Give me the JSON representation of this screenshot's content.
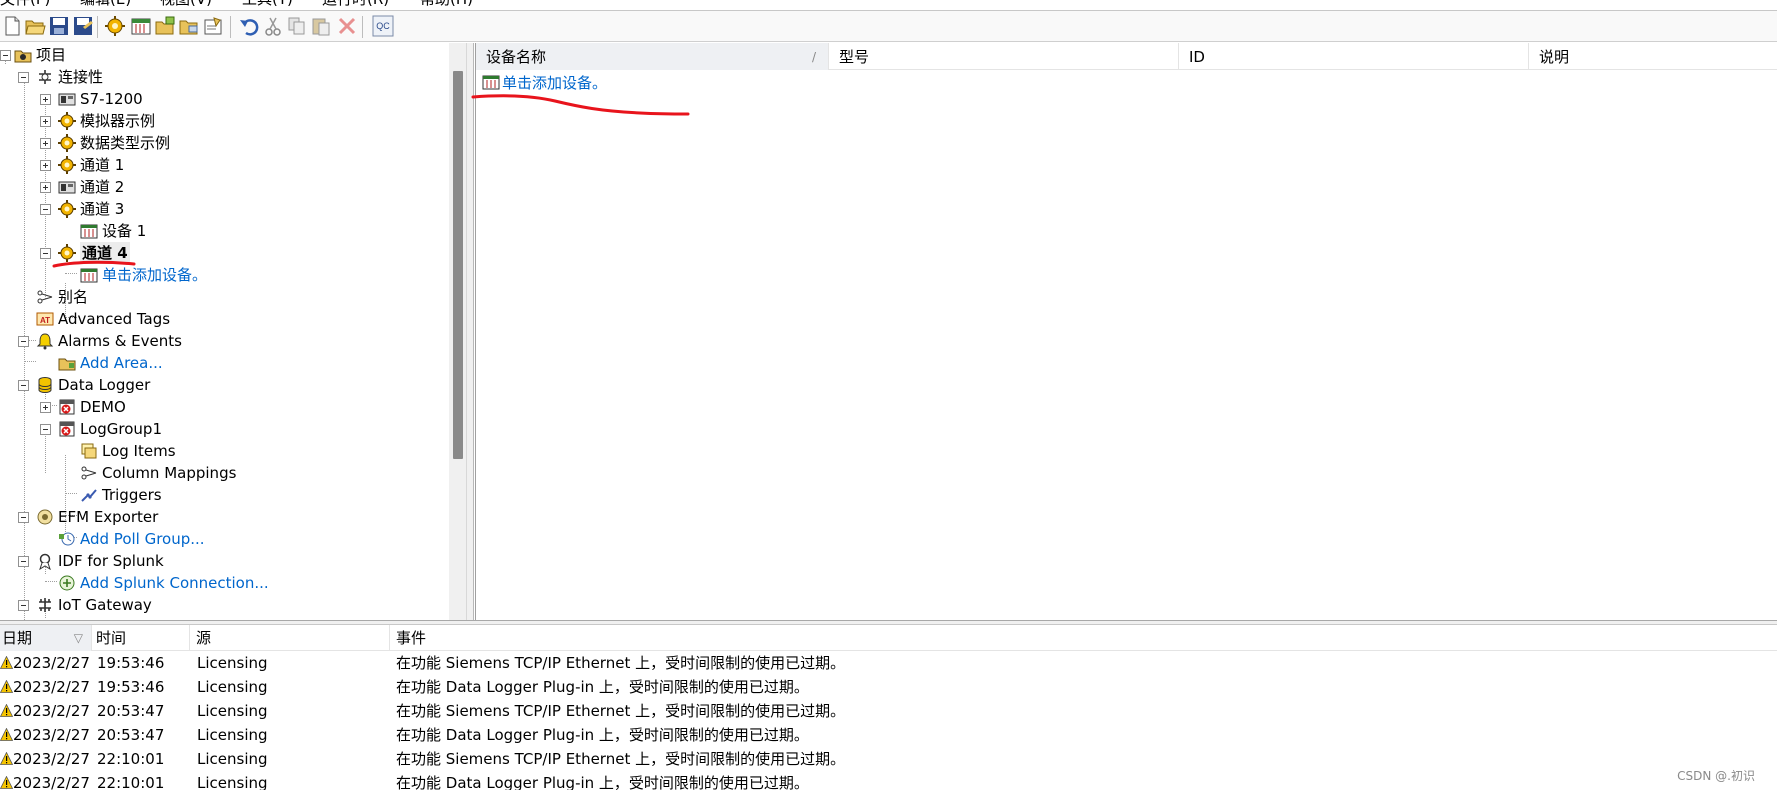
{
  "menu": {
    "items": [
      "文件(F)",
      "编辑(E)",
      "视图(V)",
      "工具(T)",
      "运行时(R)",
      "帮助(H)"
    ]
  },
  "toolbar": {
    "buttons": [
      "new-file-icon",
      "open-folder-icon",
      "save-icon",
      "save-as-icon",
      "new-channel-icon",
      "new-device-icon",
      "new-tag-group-icon",
      "new-folder-icon",
      "properties-icon",
      "undo-icon",
      "cut-icon",
      "copy-icon",
      "paste-icon",
      "delete-icon",
      "quick-client-icon"
    ],
    "quick_client_label": "QC"
  },
  "tree": {
    "project": "项目",
    "connectivity": "连接性",
    "nodes": {
      "s7": "S7-1200",
      "simulator": "模拟器示例",
      "datatype": "数据类型示例",
      "ch1": "通道 1",
      "ch2": "通道 2",
      "ch3": "通道 3",
      "device1": "设备 1",
      "ch4": "通道 4",
      "add_device": "单击添加设备。",
      "alias": "别名",
      "advanced_tags": "Advanced Tags",
      "alarms": "Alarms & Events",
      "add_area": "Add Area...",
      "data_logger": "Data Logger",
      "demo": "DEMO",
      "loggroup1": "LogGroup1",
      "log_items": "Log Items",
      "column_mappings": "Column Mappings",
      "triggers": "Triggers",
      "efm_exporter": "EFM Exporter",
      "add_poll_group": "Add Poll Group...",
      "idf_splunk": "IDF for Splunk",
      "add_splunk": "Add Splunk Connection...",
      "iot_gateway": "IoT Gateway"
    }
  },
  "detail": {
    "columns": {
      "name": "设备名称",
      "model": "型号",
      "id": "ID",
      "description": "说明"
    },
    "sort_indicator": "/",
    "add_device": "单击添加设备。"
  },
  "log": {
    "columns": {
      "date": "日期",
      "time": "时间",
      "source": "源",
      "event": "事件"
    },
    "sort_indicator": "▽",
    "rows": [
      {
        "date": "2023/2/27",
        "time": "19:53:46",
        "source": "Licensing",
        "event": "在功能 Siemens TCP/IP Ethernet 上，受时间限制的使用已过期。"
      },
      {
        "date": "2023/2/27",
        "time": "19:53:46",
        "source": "Licensing",
        "event": "在功能 Data Logger Plug-in 上，受时间限制的使用已过期。"
      },
      {
        "date": "2023/2/27",
        "time": "20:53:47",
        "source": "Licensing",
        "event": "在功能 Siemens TCP/IP Ethernet 上，受时间限制的使用已过期。"
      },
      {
        "date": "2023/2/27",
        "time": "20:53:47",
        "source": "Licensing",
        "event": "在功能 Data Logger Plug-in 上，受时间限制的使用已过期。"
      },
      {
        "date": "2023/2/27",
        "time": "22:10:01",
        "source": "Licensing",
        "event": "在功能 Siemens TCP/IP Ethernet 上，受时间限制的使用已过期。"
      },
      {
        "date": "2023/2/27",
        "time": "22:10:01",
        "source": "Licensing",
        "event": "在功能 Data Logger Plug-in 上，受时间限制的使用已过期。"
      }
    ]
  },
  "watermark": "CSDN @.初识",
  "colors": {
    "link": "#0066cc",
    "annotation": "#e8141c",
    "warning": "#f5c400"
  }
}
